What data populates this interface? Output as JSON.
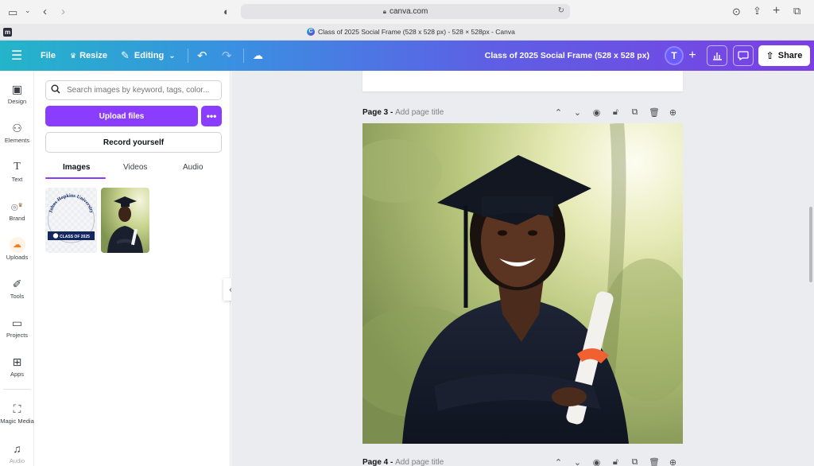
{
  "browser": {
    "url": "canva.com",
    "tab_title": "Class of 2025 Social Frame (528 x 528 px) - 528 × 528px - Canva",
    "favicon_letter": "m",
    "tab_favicon_letter": "C"
  },
  "header": {
    "file_label": "File",
    "resize_label": "Resize",
    "editing_label": "Editing",
    "doc_title": "Class of 2025 Social Frame (528 x 528 px)",
    "avatar_initial": "T",
    "share_label": "Share"
  },
  "rail": {
    "items": [
      {
        "label": "Design",
        "icon": "design-icon"
      },
      {
        "label": "Elements",
        "icon": "elements-icon"
      },
      {
        "label": "Text",
        "icon": "text-icon"
      },
      {
        "label": "Brand",
        "icon": "brand-icon"
      },
      {
        "label": "Uploads",
        "icon": "uploads-icon"
      },
      {
        "label": "Tools",
        "icon": "tools-icon"
      },
      {
        "label": "Projects",
        "icon": "folder-icon"
      },
      {
        "label": "Apps",
        "icon": "apps-icon"
      },
      {
        "label": "Magic Media",
        "icon": "magic-media-icon"
      },
      {
        "label": "Audio",
        "icon": "audio-icon"
      }
    ]
  },
  "panel": {
    "search_placeholder": "Search images by keyword, tags, color...",
    "upload_label": "Upload files",
    "more_label": "•••",
    "record_label": "Record yourself",
    "tabs": [
      "Images",
      "Videos",
      "Audio"
    ],
    "thumb1": {
      "arc_text": "Johns Hopkins University",
      "band_text": "CLASS OF 2025"
    }
  },
  "canvas": {
    "page3_label": "Page 3 - ",
    "page3_placeholder": "Add page title",
    "page4_label": "Page 4 - ",
    "page4_placeholder": "Add page title"
  },
  "colors": {
    "accent": "#8b3dff",
    "uploads_active": "#ff7a1a",
    "header_gradient_start": "#23b5c9",
    "header_gradient_end": "#7b3fe3"
  }
}
